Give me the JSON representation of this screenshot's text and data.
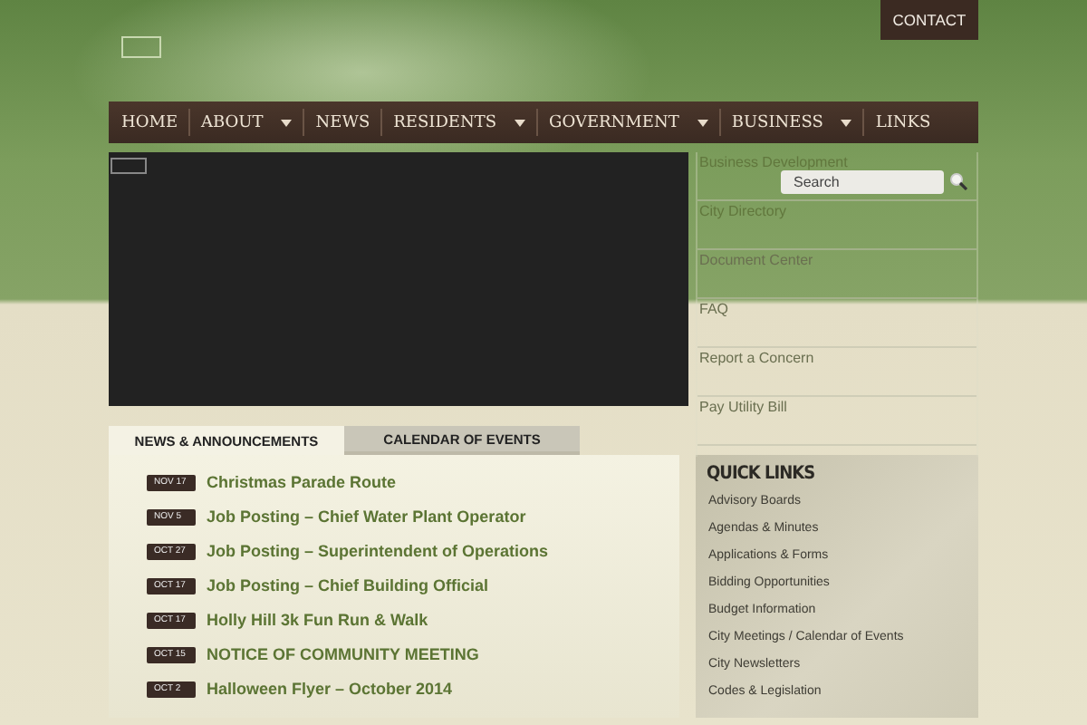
{
  "header": {
    "contact_button": "CONTACT"
  },
  "nav": [
    {
      "label": "HOME",
      "dropdown": false
    },
    {
      "label": "ABOUT",
      "dropdown": true
    },
    {
      "label": "NEWS",
      "dropdown": false
    },
    {
      "label": "RESIDENTS",
      "dropdown": true
    },
    {
      "label": "GOVERNMENT",
      "dropdown": true
    },
    {
      "label": "BUSINESS",
      "dropdown": true
    },
    {
      "label": "LINKS",
      "dropdown": false
    }
  ],
  "search": {
    "placeholder": "Search"
  },
  "side_links": [
    "Business Development",
    "City Directory",
    "Document Center",
    "FAQ",
    "Report a Concern",
    "Pay Utility Bill"
  ],
  "tabs": [
    {
      "label": "NEWS & ANNOUNCEMENTS",
      "selected": true
    },
    {
      "label": "CALENDAR OF EVENTS",
      "selected": false
    }
  ],
  "news": [
    {
      "date": "NOV 17",
      "title": "Christmas Parade Route"
    },
    {
      "date": "NOV 5",
      "title": "Job Posting – Chief Water Plant Operator"
    },
    {
      "date": "OCT 27",
      "title": "Job Posting – Superintendent of Operations"
    },
    {
      "date": "OCT 17",
      "title": "Job Posting – Chief Building Official"
    },
    {
      "date": "OCT 17",
      "title": "Holly Hill 3k Fun Run & Walk"
    },
    {
      "date": "OCT 15",
      "title": "NOTICE OF COMMUNITY MEETING"
    },
    {
      "date": "OCT 2",
      "title": "Halloween Flyer – October 2014"
    }
  ],
  "quick_links": {
    "title": "QUICK LINKS",
    "items": [
      "Advisory Boards",
      "Agendas & Minutes",
      "Applications & Forms",
      "Bidding Opportunities",
      "Budget Information",
      "City Meetings / Calendar of Events",
      "City Newsletters",
      "Codes & Legislation"
    ]
  }
}
